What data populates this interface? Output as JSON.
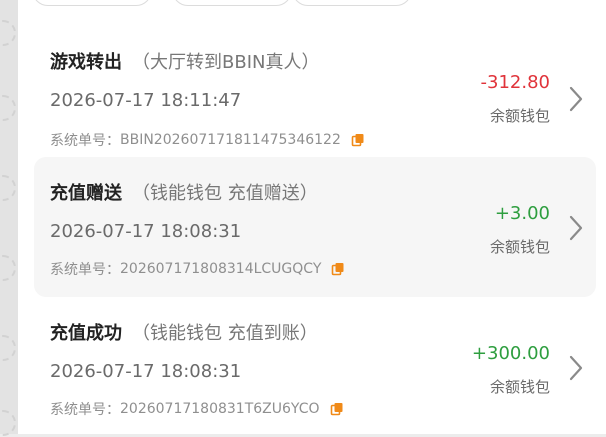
{
  "colors": {
    "negative": "#e0333a",
    "positive": "#2e9e3f",
    "copy_icon": "#f08a18"
  },
  "records": [
    {
      "title": "游戏转出",
      "detail": "（大厅转到BBIN真人）",
      "time": "2026-07-17 18:11:47",
      "order_label": "系统单号：",
      "order_no": "BBIN20260717181147534612​2",
      "amount": "-312.80",
      "wallet": "余额钱包",
      "direction": "negative"
    },
    {
      "title": "充值赠送",
      "detail": "（钱能钱包 充值赠送）",
      "time": "2026-07-17 18:08:31",
      "order_label": "系统单号：",
      "order_no": "202607171808314LCUGQCY",
      "amount": "+3.00",
      "wallet": "余额钱包",
      "direction": "positive"
    },
    {
      "title": "充值成功",
      "detail": "（钱能钱包 充值到账）",
      "time": "2026-07-17 18:08:31",
      "order_label": "系统单号：",
      "order_no": "20260717180831T6ZU6YCO",
      "amount": "+300.00",
      "wallet": "余额钱包",
      "direction": "positive"
    }
  ]
}
